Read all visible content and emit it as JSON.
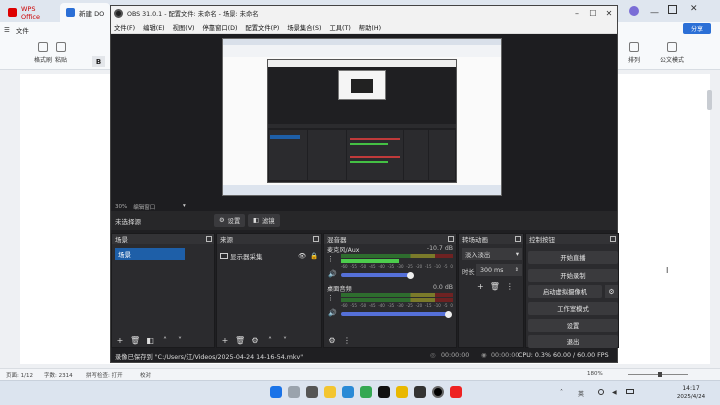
{
  "wps": {
    "tabs": [
      {
        "label": "WPS Office"
      },
      {
        "label": "新建 DOCX 文"
      }
    ],
    "file_menu": "文件",
    "toolbar": [
      {
        "label": "格式刷"
      },
      {
        "label": "粘贴"
      }
    ],
    "right_tools": [
      {
        "label": "排列"
      },
      {
        "label": "公文模式"
      }
    ],
    "share_label": "分享",
    "status": {
      "page": "页面: 1/12",
      "words": "字数: 2314",
      "spell": "拼写检查: 打开",
      "proof": "校对",
      "zoom": "180%"
    }
  },
  "obs": {
    "title": "OBS 31.0.1 - 配置文件: 未命名 - 场景: 未命名",
    "menu": [
      "文件(F)",
      "编辑(E)",
      "视图(V)",
      "停靠窗口(D)",
      "配置文件(P)",
      "场景集合(S)",
      "工具(T)",
      "帮助(H)"
    ],
    "zoom_label": "30%",
    "zoom_desc": "编辑窗口",
    "no_source": "未选择源",
    "settings_btn": "设置",
    "filter_btn": "滤镜",
    "scenes": {
      "title": "场景",
      "items": [
        "场景"
      ]
    },
    "sources": {
      "title": "来源",
      "items": [
        "显示器采集"
      ]
    },
    "mixer": {
      "title": "混音器",
      "tracks": [
        {
          "name": "麦克风/Aux",
          "db": "-10.7 dB",
          "level": 0.56
        },
        {
          "name": "桌面音频",
          "db": "0.0 dB",
          "level": 1.0
        }
      ],
      "scale": [
        "-60",
        "-55",
        "-50",
        "-45",
        "-40",
        "-35",
        "-30",
        "-25",
        "-20",
        "-15",
        "-10",
        "-5",
        "0"
      ]
    },
    "transitions": {
      "title": "转场动画",
      "mode": "淡入淡出",
      "duration_label": "时长",
      "duration_value": "300 ms"
    },
    "controls": {
      "title": "控制按钮",
      "buttons": [
        "开始直播",
        "开始录制",
        "启动虚拟摄像机",
        "工作室模式",
        "设置",
        "退出"
      ]
    },
    "status": {
      "saved": "录像已保存到 \"C:/Users/江/Videos/2025-04-24 14-16-54.mkv\"",
      "stream_time": "00:00:00",
      "rec_time": "00:00:00",
      "cpu": "CPU: 0.3%",
      "fps": "60.00 / 60.00 FPS"
    }
  },
  "clock": {
    "time": "14:17",
    "date": "2025/4/24"
  },
  "ime": "英",
  "colors": {
    "accent": "#1e5fa8",
    "obs_bg": "#2b2b2e",
    "wps_red": "#cc0000"
  }
}
